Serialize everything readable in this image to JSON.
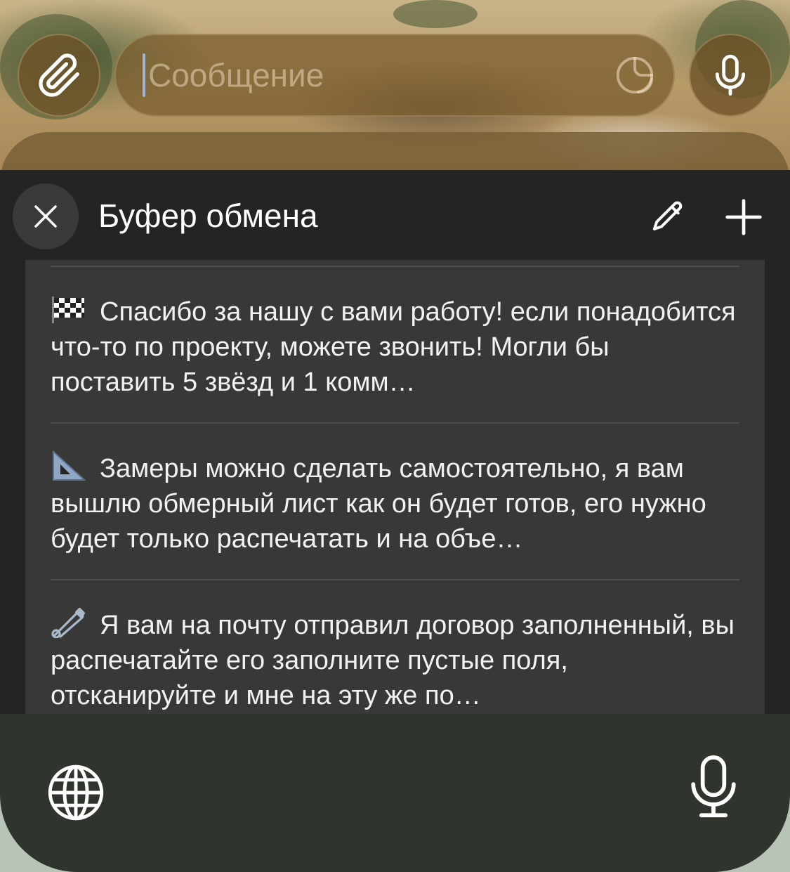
{
  "composer": {
    "placeholder": "Сообщение",
    "attach_icon": "paperclip-icon",
    "sticker_icon": "sticker-icon",
    "mic_icon": "microphone-icon"
  },
  "clipboard": {
    "title": "Буфер обмена",
    "close_icon": "close-icon",
    "edit_icon": "pencil-icon",
    "add_icon": "plus-icon",
    "items": [
      {
        "emoji": "checkered-flag",
        "text": "Спасибо за нашу с вами работу! если понадобится что-то по проекту, можете звонить! Могли бы поставить 5 звёзд и 1 комм…"
      },
      {
        "emoji": "triangular-ruler",
        "text": "Замеры можно сделать самостоятельно, я вам вышлю обмерный лист как он будет готов, его нужно будет только распечатать и на объе…"
      },
      {
        "emoji": "safety-pin",
        "text": "Я вам на почту отправил договор заполненный, вы распечатайте его заполните пустые поля, отсканируйте и мне на эту же по…"
      }
    ]
  },
  "keyboard": {
    "globe_icon": "globe-icon",
    "dictation_icon": "microphone-icon"
  },
  "colors": {
    "panel_bg": "#242424",
    "list_bg": "#383838",
    "divider": "#4e4e4e",
    "text": "#f2f2f2",
    "keyboard_bg": "#2f342d"
  }
}
